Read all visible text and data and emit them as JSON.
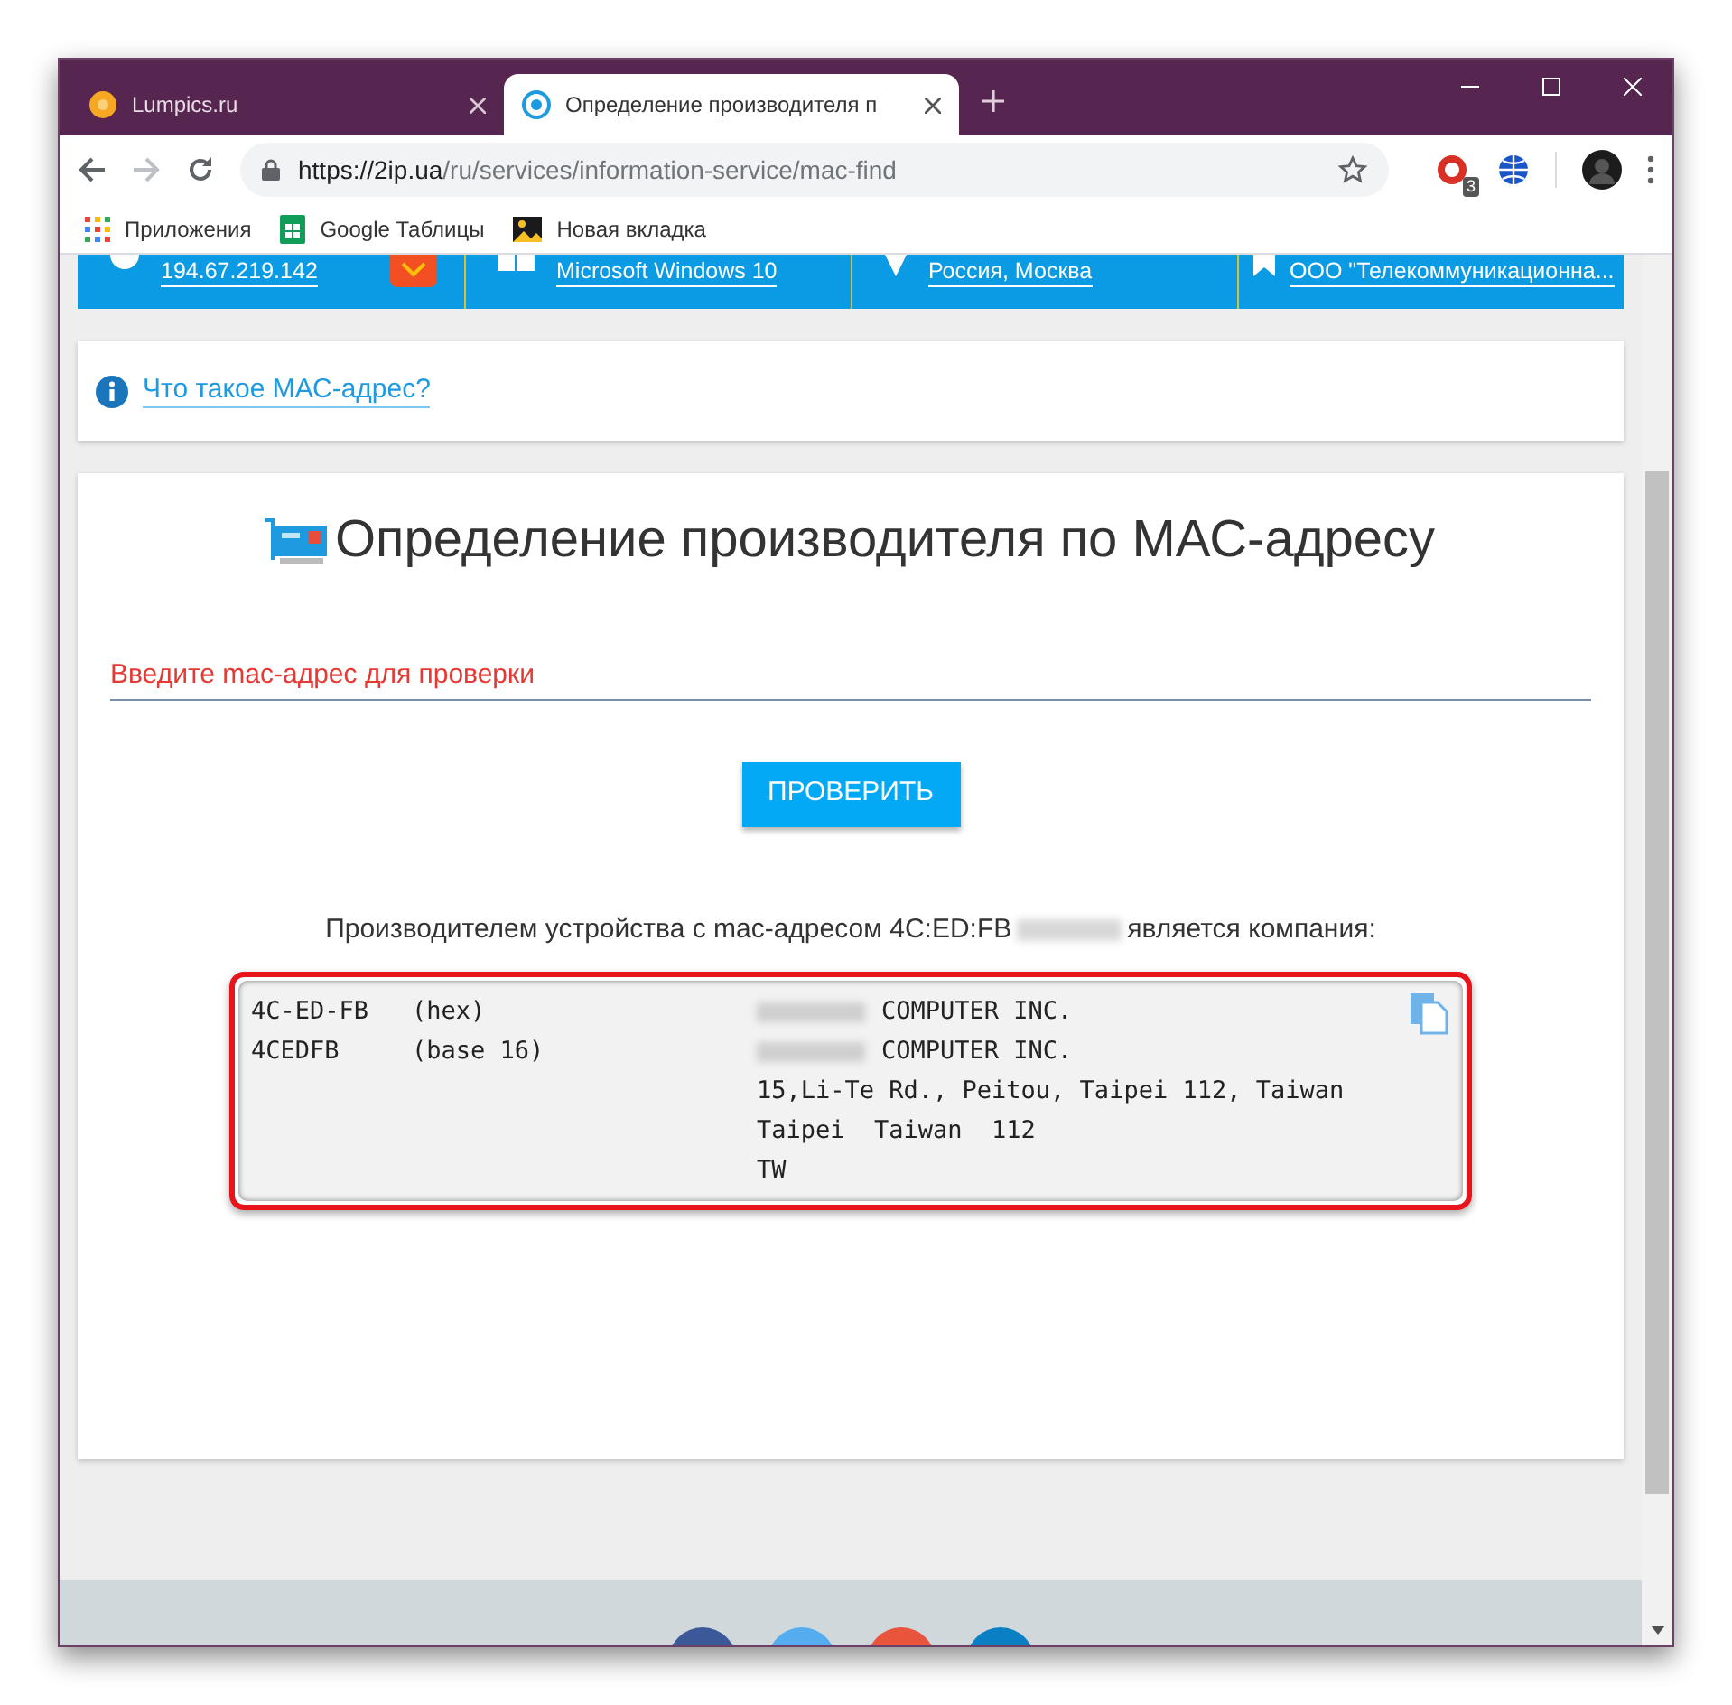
{
  "tabs": [
    {
      "title": "Lumpics.ru",
      "selected": false
    },
    {
      "title": "Определение производителя п",
      "selected": true
    }
  ],
  "address_bar": {
    "host": "https://2ip.ua",
    "path": "/ru/services/information-service/mac-find"
  },
  "extension_badge": "3",
  "bookmarks": [
    {
      "label": "Приложения"
    },
    {
      "label": "Google Таблицы"
    },
    {
      "label": "Новая вкладка"
    }
  ],
  "info_banner": [
    {
      "text": "194.67.219.142"
    },
    {
      "text": "Microsoft Windows 10"
    },
    {
      "text": "Россия, Москва"
    },
    {
      "text": "ООО \"Телекоммуникационна..."
    }
  ],
  "help_link": "Что такое МАС-адрес?",
  "heading": "Определение производителя по МАС-адресу",
  "mac_field": {
    "placeholder": "Введите mac-адрес для проверки"
  },
  "check_button": "ПРОВЕРИТЬ",
  "result_sentence": {
    "before": "Производителем устройства с mac-адресом 4C:ED:FB",
    "after": "является компания:"
  },
  "result_rows": [
    {
      "column_1": "4C-ED-FB",
      "column_2": "(hex)",
      "column_3": "COMPUTER INC.",
      "redacted": true
    },
    {
      "column_1": "4CEDFB",
      "column_2": "(base 16)",
      "column_3": "COMPUTER INC.",
      "redacted": true
    },
    {
      "column_3": "15,Li-Te Rd., Peitou, Taipei 112, Taiwan",
      "redacted": false
    },
    {
      "column_3": "Taipei  Taiwan  112",
      "redacted": false
    },
    {
      "column_3": "TW",
      "redacted": false
    }
  ],
  "social_buttons": [
    {
      "color": "#3b5998"
    },
    {
      "color": "#55acee"
    },
    {
      "color": "#e9543d"
    },
    {
      "color": "#0a7fc4"
    }
  ]
}
